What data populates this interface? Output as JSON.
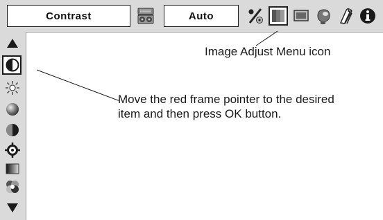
{
  "menu": {
    "item_name": "Contrast",
    "item_value": "Auto"
  },
  "toolbar": {
    "icons": [
      "remote-control-icon",
      "percent-icon",
      "image-adjust-icon",
      "screen-icon",
      "lamp-icon",
      "tools-icon",
      "info-icon"
    ],
    "selected_icon": "image-adjust-icon"
  },
  "sidebar": {
    "items": [
      "scroll-up-arrow",
      "contrast-icon",
      "brightness-icon",
      "color-icon",
      "tint-icon",
      "sharpness-icon",
      "gamma-icon",
      "color-temperature-icon",
      "scroll-down-arrow"
    ],
    "selected_item": "contrast-icon"
  },
  "callouts": {
    "icon_label": "Image Adjust Menu icon",
    "instruction_line1": "Move the red frame pointer to the desired",
    "instruction_line2": "item and then press OK button."
  },
  "colors": {
    "panel_gray": "#dadada",
    "border": "#1a1a1a",
    "background": "#ffffff"
  }
}
